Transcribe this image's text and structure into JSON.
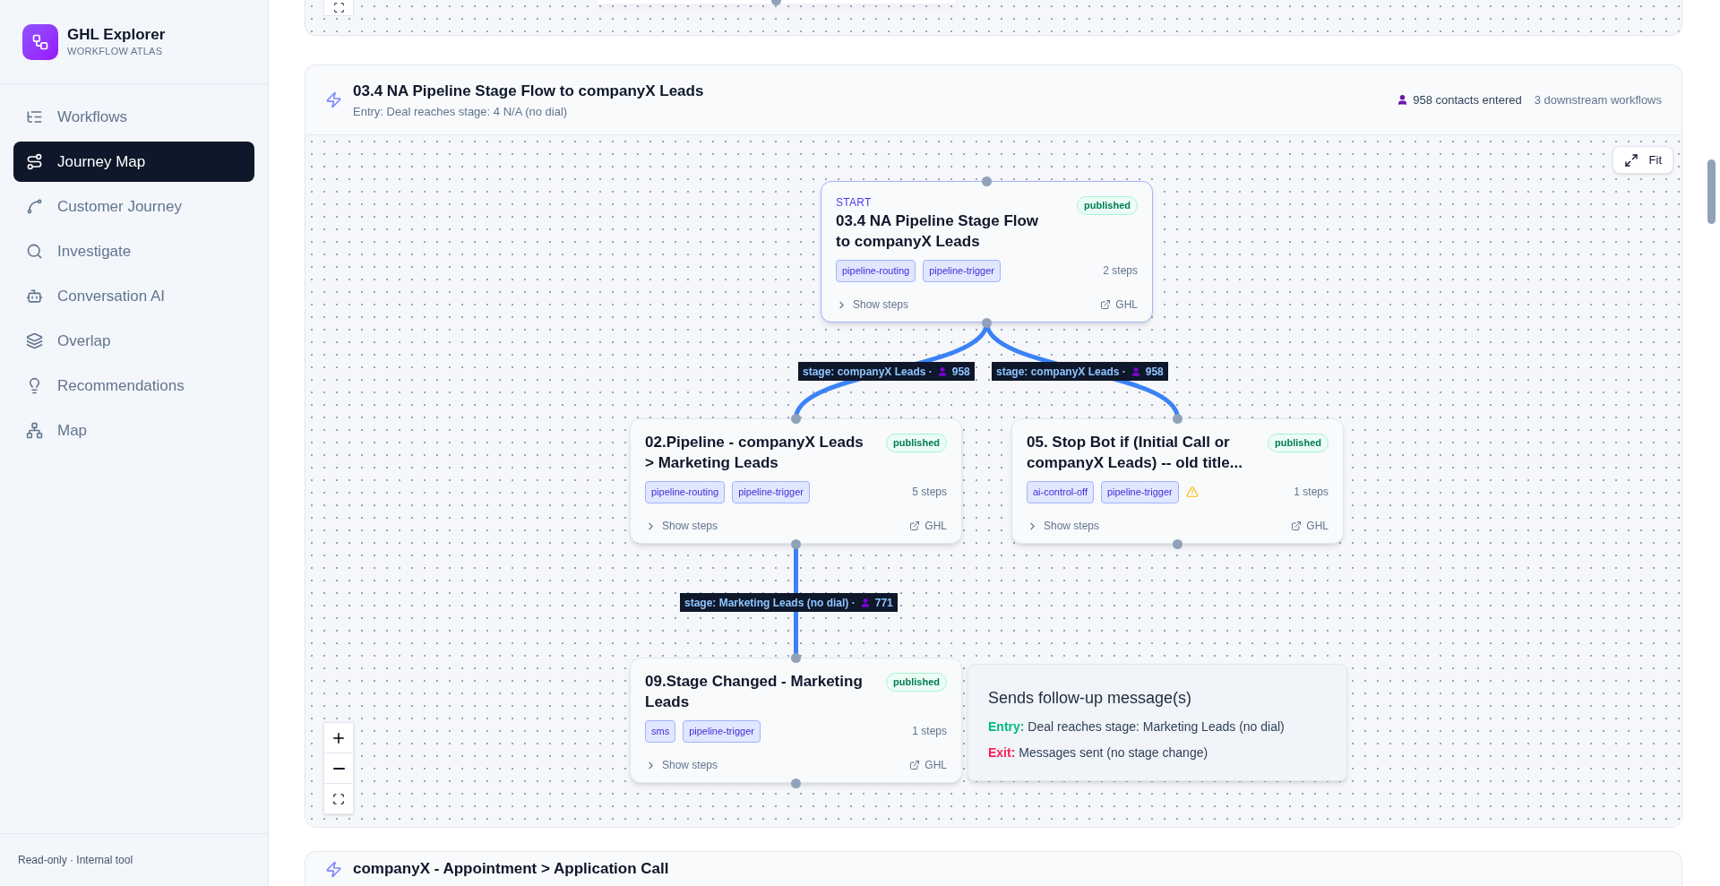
{
  "sidebar": {
    "app_name": "GHL Explorer",
    "app_subtitle": "WORKFLOW ATLAS",
    "items": [
      {
        "label": "Workflows",
        "selected": false
      },
      {
        "label": "Journey Map",
        "selected": true
      },
      {
        "label": "Customer Journey",
        "selected": false
      },
      {
        "label": "Investigate",
        "selected": false
      },
      {
        "label": "Conversation AI",
        "selected": false
      },
      {
        "label": "Overlap",
        "selected": false
      },
      {
        "label": "Recommendations",
        "selected": false
      },
      {
        "label": "Map",
        "selected": false
      }
    ],
    "footer": "Read-only · Internal tool"
  },
  "flow": {
    "title": "03.4 NA Pipeline Stage Flow to companyX Leads",
    "entry": "Entry: Deal reaches stage: 4 N/A (no dial)",
    "contacts": "958 contacts entered",
    "downstream": "3 downstream workflows",
    "canvas": {
      "fit_label": "Fit",
      "nodes": [
        {
          "kind": "start",
          "start_label": "START",
          "title": "03.4 NA Pipeline Stage Flow to companyX Leads",
          "status": "published",
          "tags": [
            "pipeline-routing",
            "pipeline-trigger"
          ],
          "warning": false,
          "steps": "2 steps",
          "show_steps": "Show steps",
          "link": "GHL"
        },
        {
          "kind": "step",
          "title": "02.Pipeline - companyX Leads > Marketing Leads",
          "status": "published",
          "tags": [
            "pipeline-routing",
            "pipeline-trigger"
          ],
          "warning": false,
          "steps": "5 steps",
          "show_steps": "Show steps",
          "link": "GHL"
        },
        {
          "kind": "step",
          "title": "05. Stop Bot if (Initial Call or companyX Leads) -- old title...",
          "status": "published",
          "tags": [
            "ai-control-off",
            "pipeline-trigger"
          ],
          "warning": true,
          "steps": "1 steps",
          "show_steps": "Show steps",
          "link": "GHL"
        },
        {
          "kind": "step",
          "title": "09.Stage Changed - Marketing Leads",
          "status": "published",
          "tags": [
            "sms",
            "pipeline-trigger"
          ],
          "warning": false,
          "steps": "1 steps",
          "show_steps": "Show steps",
          "link": "GHL"
        }
      ],
      "edges": [
        {
          "label": "stage: companyX Leads ·",
          "count": "958"
        },
        {
          "label": "stage: companyX Leads ·",
          "count": "958"
        },
        {
          "label": "stage: Marketing Leads (no dial) ·",
          "count": "771"
        }
      ],
      "info_card": {
        "title": "Sends follow-up message(s)",
        "entry_label": "Entry:",
        "entry_text": "Deal reaches stage: Marketing Leads (no dial)",
        "exit_label": "Exit:",
        "exit_text": "Messages sent (no stage change)"
      }
    }
  },
  "next_flow": {
    "title": "companyX - Appointment > Application Call"
  }
}
